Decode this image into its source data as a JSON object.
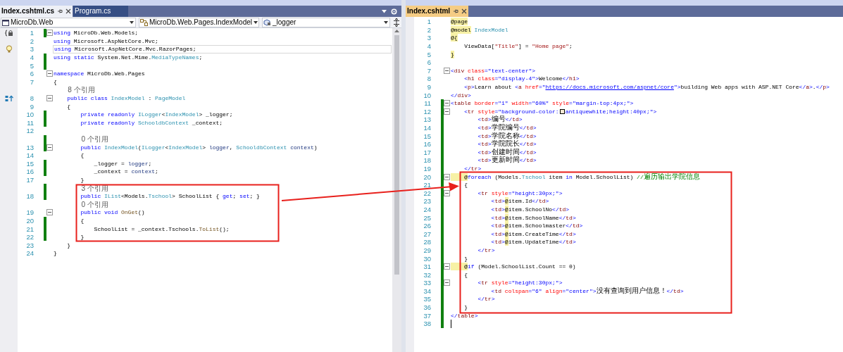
{
  "left_pane": {
    "focused": false,
    "tabs": [
      {
        "label": "Index.cshtml.cs",
        "selected": true
      },
      {
        "label": "Program.cs",
        "selected": false
      }
    ],
    "nav": {
      "project": "MicroDb.Web",
      "type": "MicroDb.Web.Pages.IndexModel",
      "member": "_logger"
    },
    "lines": [
      {
        "kind": "code",
        "number": "1",
        "changed": true,
        "fold": true,
        "margin_icon": {
          "kind": "braces"
        },
        "tokens": [
          {
            "kind": "keyword",
            "text": "using"
          },
          {
            "kind": "plain",
            "text": " MicroDb.Web.Models;"
          }
        ]
      },
      {
        "kind": "code",
        "number": "2",
        "tokens": [
          {
            "kind": "keyword",
            "text": "using"
          },
          {
            "kind": "plain",
            "text": " Microsoft.AspNetCore.Mvc;"
          }
        ]
      },
      {
        "kind": "code",
        "number": "3",
        "current": true,
        "margin_icon": {
          "kind": "bulb"
        },
        "tokens": [
          {
            "kind": "keyword",
            "text": "using"
          },
          {
            "kind": "plain",
            "text": " Microsoft.AspNetCore.Mvc.RazorPages;"
          }
        ]
      },
      {
        "kind": "code",
        "number": "4",
        "changed": true,
        "tokens": [
          {
            "kind": "keyword",
            "text": "using static"
          },
          {
            "kind": "plain",
            "text": " System.Net.Mime."
          },
          {
            "kind": "type",
            "text": "MediaTypeNames"
          },
          {
            "kind": "plain",
            "text": ";"
          }
        ]
      },
      {
        "kind": "code",
        "number": "5",
        "changed": true
      },
      {
        "kind": "code",
        "number": "6",
        "fold": true,
        "tokens": [
          {
            "kind": "keyword",
            "text": "namespace"
          },
          {
            "kind": "plain",
            "text": " MicroDb.Web.Pages"
          }
        ]
      },
      {
        "kind": "code",
        "number": "7",
        "tokens": [
          {
            "kind": "plain",
            "text": "{"
          }
        ]
      },
      {
        "kind": "lens",
        "text": "8 个引用"
      },
      {
        "kind": "code",
        "number": "8",
        "fold": true,
        "margin_icon": {
          "kind": "override"
        },
        "tokens": [
          {
            "kind": "keyword",
            "text": "    public class"
          },
          {
            "kind": "type",
            "text": " IndexModel"
          },
          {
            "kind": "plain",
            "text": " : "
          },
          {
            "kind": "type",
            "text": "PageModel"
          }
        ]
      },
      {
        "kind": "code",
        "number": "9",
        "tokens": [
          {
            "kind": "plain",
            "text": "    {"
          }
        ]
      },
      {
        "kind": "code",
        "number": "10",
        "changed": true,
        "tokens": [
          {
            "kind": "keyword",
            "text": "        private readonly"
          },
          {
            "kind": "type",
            "text": " ILogger"
          },
          {
            "kind": "plain",
            "text": "<"
          },
          {
            "kind": "type",
            "text": "IndexModel"
          },
          {
            "kind": "plain",
            "text": "> _logger;"
          }
        ]
      },
      {
        "kind": "code",
        "number": "11",
        "changed": true,
        "tokens": [
          {
            "kind": "keyword",
            "text": "        private readonly"
          },
          {
            "kind": "type",
            "text": " SchooldbContext"
          },
          {
            "kind": "plain",
            "text": " _context;"
          }
        ]
      },
      {
        "kind": "code",
        "number": "12"
      },
      {
        "kind": "lens",
        "text": "0 个引用",
        "changed": true
      },
      {
        "kind": "code",
        "number": "13",
        "changed": true,
        "fold": true,
        "tokens": [
          {
            "kind": "keyword",
            "text": "        public"
          },
          {
            "kind": "type",
            "text": " IndexModel"
          },
          {
            "kind": "plain",
            "text": "("
          },
          {
            "kind": "type",
            "text": "ILogger"
          },
          {
            "kind": "plain",
            "text": "<"
          },
          {
            "kind": "type",
            "text": "IndexModel"
          },
          {
            "kind": "plain",
            "text": "> "
          },
          {
            "kind": "param",
            "text": "logger"
          },
          {
            "kind": "plain",
            "text": ", "
          },
          {
            "kind": "type",
            "text": "SchooldbContext"
          },
          {
            "kind": "param",
            "text": " context"
          },
          {
            "kind": "plain",
            "text": ")"
          }
        ]
      },
      {
        "kind": "code",
        "number": "14",
        "tokens": [
          {
            "kind": "plain",
            "text": "        {"
          }
        ]
      },
      {
        "kind": "code",
        "number": "15",
        "changed": true,
        "tokens": [
          {
            "kind": "plain",
            "text": "            _logger = "
          },
          {
            "kind": "param",
            "text": "logger"
          },
          {
            "kind": "plain",
            "text": ";"
          }
        ]
      },
      {
        "kind": "code",
        "number": "16",
        "changed": true,
        "tokens": [
          {
            "kind": "plain",
            "text": "            _context = "
          },
          {
            "kind": "param",
            "text": "context"
          },
          {
            "kind": "plain",
            "text": ";"
          }
        ]
      },
      {
        "kind": "code",
        "number": "17",
        "tokens": [
          {
            "kind": "plain",
            "text": "        }"
          }
        ]
      },
      {
        "kind": "lens",
        "text": "3 个引用",
        "changed": true
      },
      {
        "kind": "code",
        "number": "18",
        "changed": true,
        "tokens": [
          {
            "kind": "keyword",
            "text": "        public"
          },
          {
            "kind": "type",
            "text": " IList"
          },
          {
            "kind": "plain",
            "text": "<Models."
          },
          {
            "kind": "type",
            "text": "Tschool"
          },
          {
            "kind": "plain",
            "text": "> SchoolList { "
          },
          {
            "kind": "keyword",
            "text": "get"
          },
          {
            "kind": "plain",
            "text": "; "
          },
          {
            "kind": "keyword",
            "text": "set"
          },
          {
            "kind": "plain",
            "text": "; }"
          }
        ]
      },
      {
        "kind": "lens",
        "text": "0 个引用"
      },
      {
        "kind": "code",
        "number": "19",
        "fold": true,
        "tokens": [
          {
            "kind": "keyword",
            "text": "        public void"
          },
          {
            "kind": "method",
            "text": " OnGet"
          },
          {
            "kind": "plain",
            "text": "()"
          }
        ]
      },
      {
        "kind": "code",
        "number": "20",
        "changed": true,
        "tokens": [
          {
            "kind": "plain",
            "text": "        {"
          }
        ]
      },
      {
        "kind": "code",
        "number": "21",
        "changed": true,
        "tokens": [
          {
            "kind": "plain",
            "text": "            SchoolList = _context.Tschools."
          },
          {
            "kind": "method",
            "text": "ToList"
          },
          {
            "kind": "plain",
            "text": "();"
          }
        ]
      },
      {
        "kind": "code",
        "number": "22",
        "changed": true,
        "tokens": [
          {
            "kind": "plain",
            "text": "        }"
          }
        ]
      },
      {
        "kind": "code",
        "number": "23",
        "tokens": [
          {
            "kind": "plain",
            "text": "    }"
          }
        ]
      },
      {
        "kind": "code",
        "number": "24",
        "tokens": [
          {
            "kind": "plain",
            "text": "}"
          }
        ]
      }
    ]
  },
  "right_pane": {
    "focused": true,
    "tabs": [
      {
        "label": "Index.cshtml",
        "selected": true
      }
    ],
    "lines": [
      {
        "kind": "code",
        "number": "1",
        "tokens": [
          {
            "kind": "razor",
            "text": "@page"
          }
        ]
      },
      {
        "kind": "code",
        "number": "2",
        "tokens": [
          {
            "kind": "razor",
            "text": "@model"
          },
          {
            "kind": "type",
            "text": " IndexModel"
          }
        ]
      },
      {
        "kind": "code",
        "number": "3",
        "tokens": [
          {
            "kind": "razor",
            "text": "@{"
          }
        ]
      },
      {
        "kind": "code",
        "number": "4",
        "tokens": [
          {
            "kind": "plain",
            "text": "    ViewData["
          },
          {
            "kind": "string",
            "text": "\"Title\""
          },
          {
            "kind": "plain",
            "text": "] = "
          },
          {
            "kind": "string",
            "text": "\"Home page\""
          },
          {
            "kind": "plain",
            "text": ";"
          }
        ]
      },
      {
        "kind": "code",
        "number": "5",
        "tokens": [
          {
            "kind": "razor",
            "text": "}"
          }
        ]
      },
      {
        "kind": "code",
        "number": "6"
      },
      {
        "kind": "code",
        "number": "7",
        "fold": true,
        "tokens": [
          {
            "kind": "bracket",
            "text": "<"
          },
          {
            "kind": "tag",
            "text": "div"
          },
          {
            "kind": "attribute",
            "text": " class"
          },
          {
            "kind": "bracket",
            "text": "="
          },
          {
            "kind": "value",
            "text": "\"text-center\""
          },
          {
            "kind": "bracket",
            "text": ">"
          }
        ]
      },
      {
        "kind": "code",
        "number": "8",
        "tokens": [
          {
            "kind": "bracket",
            "text": "    <"
          },
          {
            "kind": "tag",
            "text": "h1"
          },
          {
            "kind": "attribute",
            "text": " class"
          },
          {
            "kind": "bracket",
            "text": "="
          },
          {
            "kind": "value",
            "text": "\"display-4\""
          },
          {
            "kind": "bracket",
            "text": ">"
          },
          {
            "kind": "plain",
            "text": "Welcome"
          },
          {
            "kind": "bracket",
            "text": "</"
          },
          {
            "kind": "tag",
            "text": "h1"
          },
          {
            "kind": "bracket",
            "text": ">"
          }
        ]
      },
      {
        "kind": "code",
        "number": "9",
        "tokens": [
          {
            "kind": "bracket",
            "text": "    <"
          },
          {
            "kind": "tag",
            "text": "p"
          },
          {
            "kind": "bracket",
            "text": ">"
          },
          {
            "kind": "plain",
            "text": "Learn about "
          },
          {
            "kind": "bracket",
            "text": "<"
          },
          {
            "kind": "tag",
            "text": "a"
          },
          {
            "kind": "attribute",
            "text": " href"
          },
          {
            "kind": "bracket",
            "text": "="
          },
          {
            "kind": "value",
            "text": "\""
          },
          {
            "kind": "link",
            "text": "https://docs.microsoft.com/aspnet/core"
          },
          {
            "kind": "value",
            "text": "\""
          },
          {
            "kind": "bracket",
            "text": ">"
          },
          {
            "kind": "plain",
            "text": "building Web apps with ASP.NET Core"
          },
          {
            "kind": "bracket",
            "text": "</"
          },
          {
            "kind": "tag",
            "text": "a"
          },
          {
            "kind": "bracket",
            "text": ">"
          },
          {
            "kind": "plain",
            "text": "."
          },
          {
            "kind": "bracket",
            "text": "</"
          },
          {
            "kind": "tag",
            "text": "p"
          },
          {
            "kind": "bracket",
            "text": ">"
          }
        ]
      },
      {
        "kind": "code",
        "number": "10",
        "tokens": [
          {
            "kind": "bracket",
            "text": "</"
          },
          {
            "kind": "tag",
            "text": "div"
          },
          {
            "kind": "bracket",
            "text": ">"
          }
        ]
      },
      {
        "kind": "code",
        "number": "11",
        "changed": true,
        "fold": true,
        "tokens": [
          {
            "kind": "bracket",
            "text": "<"
          },
          {
            "kind": "tag",
            "text": "table"
          },
          {
            "kind": "attribute",
            "text": " border"
          },
          {
            "kind": "bracket",
            "text": "="
          },
          {
            "kind": "value",
            "text": "\"1\""
          },
          {
            "kind": "attribute",
            "text": " width"
          },
          {
            "kind": "bracket",
            "text": "="
          },
          {
            "kind": "value",
            "text": "\"60%\""
          },
          {
            "kind": "attribute",
            "text": " style"
          },
          {
            "kind": "bracket",
            "text": "="
          },
          {
            "kind": "value",
            "text": "\"margin-top:4px;\""
          },
          {
            "kind": "bracket",
            "text": ">"
          }
        ]
      },
      {
        "kind": "code",
        "number": "12",
        "changed": true,
        "fold": true,
        "tokens": [
          {
            "kind": "bracket",
            "text": "    <"
          },
          {
            "kind": "tag",
            "text": "tr"
          },
          {
            "kind": "attribute",
            "text": " style"
          },
          {
            "kind": "bracket",
            "text": "="
          },
          {
            "kind": "value",
            "text": "\"background-color:"
          },
          {
            "kind": "swatch"
          },
          {
            "kind": "value",
            "text": "antiquewhite;height:40px;\""
          },
          {
            "kind": "bracket",
            "text": ">"
          }
        ]
      },
      {
        "kind": "code",
        "number": "13",
        "changed": true,
        "tokens": [
          {
            "kind": "bracket",
            "text": "        <"
          },
          {
            "kind": "tag",
            "text": "td"
          },
          {
            "kind": "bracket",
            "text": ">"
          },
          {
            "kind": "plain_cjk",
            "text": "编号"
          },
          {
            "kind": "bracket",
            "text": "</"
          },
          {
            "kind": "tag",
            "text": "td"
          },
          {
            "kind": "bracket",
            "text": ">"
          }
        ]
      },
      {
        "kind": "code",
        "number": "14",
        "changed": true,
        "tokens": [
          {
            "kind": "bracket",
            "text": "        <"
          },
          {
            "kind": "tag",
            "text": "td"
          },
          {
            "kind": "bracket",
            "text": ">"
          },
          {
            "kind": "plain_cjk",
            "text": "学院编号"
          },
          {
            "kind": "bracket",
            "text": "</"
          },
          {
            "kind": "tag",
            "text": "td"
          },
          {
            "kind": "bracket",
            "text": ">"
          }
        ]
      },
      {
        "kind": "code",
        "number": "15",
        "changed": true,
        "tokens": [
          {
            "kind": "bracket",
            "text": "        <"
          },
          {
            "kind": "tag",
            "text": "td"
          },
          {
            "kind": "bracket",
            "text": ">"
          },
          {
            "kind": "plain_cjk",
            "text": "学院名称"
          },
          {
            "kind": "bracket",
            "text": "</"
          },
          {
            "kind": "tag",
            "text": "td"
          },
          {
            "kind": "bracket",
            "text": ">"
          }
        ]
      },
      {
        "kind": "code",
        "number": "16",
        "changed": true,
        "tokens": [
          {
            "kind": "bracket",
            "text": "        <"
          },
          {
            "kind": "tag",
            "text": "td"
          },
          {
            "kind": "bracket",
            "text": ">"
          },
          {
            "kind": "plain_cjk",
            "text": "学院院长"
          },
          {
            "kind": "bracket",
            "text": "</"
          },
          {
            "kind": "tag",
            "text": "td"
          },
          {
            "kind": "bracket",
            "text": ">"
          }
        ]
      },
      {
        "kind": "code",
        "number": "17",
        "changed": true,
        "tokens": [
          {
            "kind": "bracket",
            "text": "        <"
          },
          {
            "kind": "tag",
            "text": "td"
          },
          {
            "kind": "bracket",
            "text": ">"
          },
          {
            "kind": "plain_cjk",
            "text": "创建时间"
          },
          {
            "kind": "bracket",
            "text": "</"
          },
          {
            "kind": "tag",
            "text": "td"
          },
          {
            "kind": "bracket",
            "text": ">"
          }
        ]
      },
      {
        "kind": "code",
        "number": "18",
        "changed": true,
        "tokens": [
          {
            "kind": "bracket",
            "text": "        <"
          },
          {
            "kind": "tag",
            "text": "td"
          },
          {
            "kind": "bracket",
            "text": ">"
          },
          {
            "kind": "plain_cjk",
            "text": "更新时间"
          },
          {
            "kind": "bracket",
            "text": "</"
          },
          {
            "kind": "tag",
            "text": "td"
          },
          {
            "kind": "bracket",
            "text": ">"
          }
        ]
      },
      {
        "kind": "code",
        "number": "19",
        "changed": true,
        "tokens": [
          {
            "kind": "bracket",
            "text": "    </"
          },
          {
            "kind": "tag",
            "text": "tr"
          },
          {
            "kind": "bracket",
            "text": ">"
          }
        ]
      },
      {
        "kind": "code",
        "number": "20",
        "changed": true,
        "fold": true,
        "tokens": [
          {
            "kind": "razor",
            "text": "    @"
          },
          {
            "kind": "keyword",
            "text": "foreach"
          },
          {
            "kind": "plain",
            "text": " (Models."
          },
          {
            "kind": "type",
            "text": "Tschool"
          },
          {
            "kind": "plain",
            "text": " item "
          },
          {
            "kind": "keyword",
            "text": "in"
          },
          {
            "kind": "plain",
            "text": " Model.SchoolList) "
          },
          {
            "kind": "comment",
            "text": "//"
          },
          {
            "kind": "comment_cjk",
            "text": "遍历输出学院信息"
          }
        ]
      },
      {
        "kind": "code",
        "number": "21",
        "changed": true,
        "tokens": [
          {
            "kind": "plain",
            "text": "    {"
          }
        ]
      },
      {
        "kind": "code",
        "number": "22",
        "changed": true,
        "fold": true,
        "tokens": [
          {
            "kind": "bracket",
            "text": "        <"
          },
          {
            "kind": "tag",
            "text": "tr"
          },
          {
            "kind": "attribute",
            "text": " style"
          },
          {
            "kind": "bracket",
            "text": "="
          },
          {
            "kind": "value",
            "text": "\"height:30px;\""
          },
          {
            "kind": "bracket",
            "text": ">"
          }
        ]
      },
      {
        "kind": "code",
        "number": "23",
        "changed": true,
        "tokens": [
          {
            "kind": "bracket",
            "text": "            <"
          },
          {
            "kind": "tag",
            "text": "td"
          },
          {
            "kind": "bracket",
            "text": ">"
          },
          {
            "kind": "razor",
            "text": "@"
          },
          {
            "kind": "plain",
            "text": "item.Id"
          },
          {
            "kind": "bracket",
            "text": "</"
          },
          {
            "kind": "tag",
            "text": "td"
          },
          {
            "kind": "bracket",
            "text": ">"
          }
        ]
      },
      {
        "kind": "code",
        "number": "24",
        "changed": true,
        "tokens": [
          {
            "kind": "bracket",
            "text": "            <"
          },
          {
            "kind": "tag",
            "text": "td"
          },
          {
            "kind": "bracket",
            "text": ">"
          },
          {
            "kind": "razor",
            "text": "@"
          },
          {
            "kind": "plain",
            "text": "item.SchoolNo"
          },
          {
            "kind": "bracket",
            "text": "</"
          },
          {
            "kind": "tag",
            "text": "td"
          },
          {
            "kind": "bracket",
            "text": ">"
          }
        ]
      },
      {
        "kind": "code",
        "number": "25",
        "changed": true,
        "tokens": [
          {
            "kind": "bracket",
            "text": "            <"
          },
          {
            "kind": "tag",
            "text": "td"
          },
          {
            "kind": "bracket",
            "text": ">"
          },
          {
            "kind": "razor",
            "text": "@"
          },
          {
            "kind": "plain",
            "text": "item.SchoolName"
          },
          {
            "kind": "bracket",
            "text": "</"
          },
          {
            "kind": "tag",
            "text": "td"
          },
          {
            "kind": "bracket",
            "text": ">"
          }
        ]
      },
      {
        "kind": "code",
        "number": "26",
        "changed": true,
        "tokens": [
          {
            "kind": "bracket",
            "text": "            <"
          },
          {
            "kind": "tag",
            "text": "td"
          },
          {
            "kind": "bracket",
            "text": ">"
          },
          {
            "kind": "razor",
            "text": "@"
          },
          {
            "kind": "plain",
            "text": "item.Schoolmaster"
          },
          {
            "kind": "bracket",
            "text": "</"
          },
          {
            "kind": "tag",
            "text": "td"
          },
          {
            "kind": "bracket",
            "text": ">"
          }
        ]
      },
      {
        "kind": "code",
        "number": "27",
        "changed": true,
        "tokens": [
          {
            "kind": "bracket",
            "text": "            <"
          },
          {
            "kind": "tag",
            "text": "td"
          },
          {
            "kind": "bracket",
            "text": ">"
          },
          {
            "kind": "razor",
            "text": "@"
          },
          {
            "kind": "plain",
            "text": "item.CreateTime"
          },
          {
            "kind": "bracket",
            "text": "</"
          },
          {
            "kind": "tag",
            "text": "td"
          },
          {
            "kind": "bracket",
            "text": ">"
          }
        ]
      },
      {
        "kind": "code",
        "number": "28",
        "changed": true,
        "tokens": [
          {
            "kind": "bracket",
            "text": "            <"
          },
          {
            "kind": "tag",
            "text": "td"
          },
          {
            "kind": "bracket",
            "text": ">"
          },
          {
            "kind": "razor",
            "text": "@"
          },
          {
            "kind": "plain",
            "text": "item.UpdateTime"
          },
          {
            "kind": "bracket",
            "text": "</"
          },
          {
            "kind": "tag",
            "text": "td"
          },
          {
            "kind": "bracket",
            "text": ">"
          }
        ]
      },
      {
        "kind": "code",
        "number": "29",
        "changed": true,
        "tokens": [
          {
            "kind": "bracket",
            "text": "        </"
          },
          {
            "kind": "tag",
            "text": "tr"
          },
          {
            "kind": "bracket",
            "text": ">"
          }
        ]
      },
      {
        "kind": "code",
        "number": "30",
        "changed": true,
        "tokens": [
          {
            "kind": "plain",
            "text": "    }"
          }
        ]
      },
      {
        "kind": "code",
        "number": "31",
        "changed": true,
        "fold": true,
        "tokens": [
          {
            "kind": "razor",
            "text": "    @"
          },
          {
            "kind": "keyword",
            "text": "if"
          },
          {
            "kind": "plain",
            "text": " (Model.SchoolList.Count == 0)"
          }
        ]
      },
      {
        "kind": "code",
        "number": "32",
        "changed": true,
        "tokens": [
          {
            "kind": "plain",
            "text": "    {"
          }
        ]
      },
      {
        "kind": "code",
        "number": "33",
        "changed": true,
        "fold": true,
        "tokens": [
          {
            "kind": "bracket",
            "text": "        <"
          },
          {
            "kind": "tag",
            "text": "tr"
          },
          {
            "kind": "attribute",
            "text": " style"
          },
          {
            "kind": "bracket",
            "text": "="
          },
          {
            "kind": "value",
            "text": "\"height:30px;\""
          },
          {
            "kind": "bracket",
            "text": ">"
          }
        ]
      },
      {
        "kind": "code",
        "number": "34",
        "changed": true,
        "tokens": [
          {
            "kind": "bracket",
            "text": "            <"
          },
          {
            "kind": "tag",
            "text": "td"
          },
          {
            "kind": "attribute",
            "text": " colspan"
          },
          {
            "kind": "bracket",
            "text": "="
          },
          {
            "kind": "value",
            "text": "\"6\""
          },
          {
            "kind": "attribute",
            "text": " align"
          },
          {
            "kind": "bracket",
            "text": "="
          },
          {
            "kind": "value",
            "text": "\"center\""
          },
          {
            "kind": "bracket",
            "text": ">"
          },
          {
            "kind": "plain_cjk",
            "text": "没有查询到用户信息！"
          },
          {
            "kind": "bracket",
            "text": "</"
          },
          {
            "kind": "tag",
            "text": "td"
          },
          {
            "kind": "bracket",
            "text": ">"
          }
        ]
      },
      {
        "kind": "code",
        "number": "35",
        "changed": true,
        "tokens": [
          {
            "kind": "bracket",
            "text": "        </"
          },
          {
            "kind": "tag",
            "text": "tr"
          },
          {
            "kind": "bracket",
            "text": ">"
          }
        ]
      },
      {
        "kind": "code",
        "number": "36",
        "changed": true,
        "tokens": [
          {
            "kind": "plain",
            "text": "    }"
          }
        ]
      },
      {
        "kind": "code",
        "number": "37",
        "changed": true,
        "tokens": [
          {
            "kind": "bracket",
            "text": "</"
          },
          {
            "kind": "tag",
            "text": "table"
          },
          {
            "kind": "bracket",
            "text": ">"
          }
        ]
      },
      {
        "kind": "code",
        "number": "38",
        "changed": true,
        "current": true
      }
    ]
  }
}
